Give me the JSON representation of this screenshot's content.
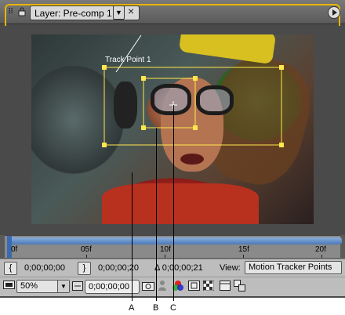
{
  "panel": {
    "tab_label": "Layer: Pre-comp 1",
    "tab_close_glyph": "×",
    "tab_dropdown_glyph": "▼",
    "accent_color": "#e8b400"
  },
  "viewer": {
    "track_point_label": "Track Point 1",
    "tracker_color": "#ffe64d"
  },
  "timeline": {
    "ticks": [
      "0f",
      "05f",
      "10f",
      "15f",
      "20f"
    ],
    "playhead_frame": "0f"
  },
  "controls_row1": {
    "in_time": "0;00;00;00",
    "out_time": "0;00;00;20",
    "duration": "Δ 0;00;00;21",
    "view_label": "View:",
    "view_value": "Motion Tracker Points"
  },
  "controls_row2": {
    "zoom": "50%",
    "current_time": "0;00;00;00"
  },
  "callouts": [
    "A",
    "B",
    "C"
  ],
  "icons": {
    "grip": "panel-grip-icon",
    "lock": "lock-icon",
    "menu": "panel-menu-icon",
    "monitor": "always-preview-icon",
    "camera": "snapshot-icon",
    "person": "show-snapshot-icon",
    "channels": "rgb-channels-icon",
    "region": "region-of-interest-icon",
    "transparency": "transparency-grid-icon",
    "pixel_aspect": "pixel-aspect-icon",
    "flowchart": "flowchart-icon"
  }
}
